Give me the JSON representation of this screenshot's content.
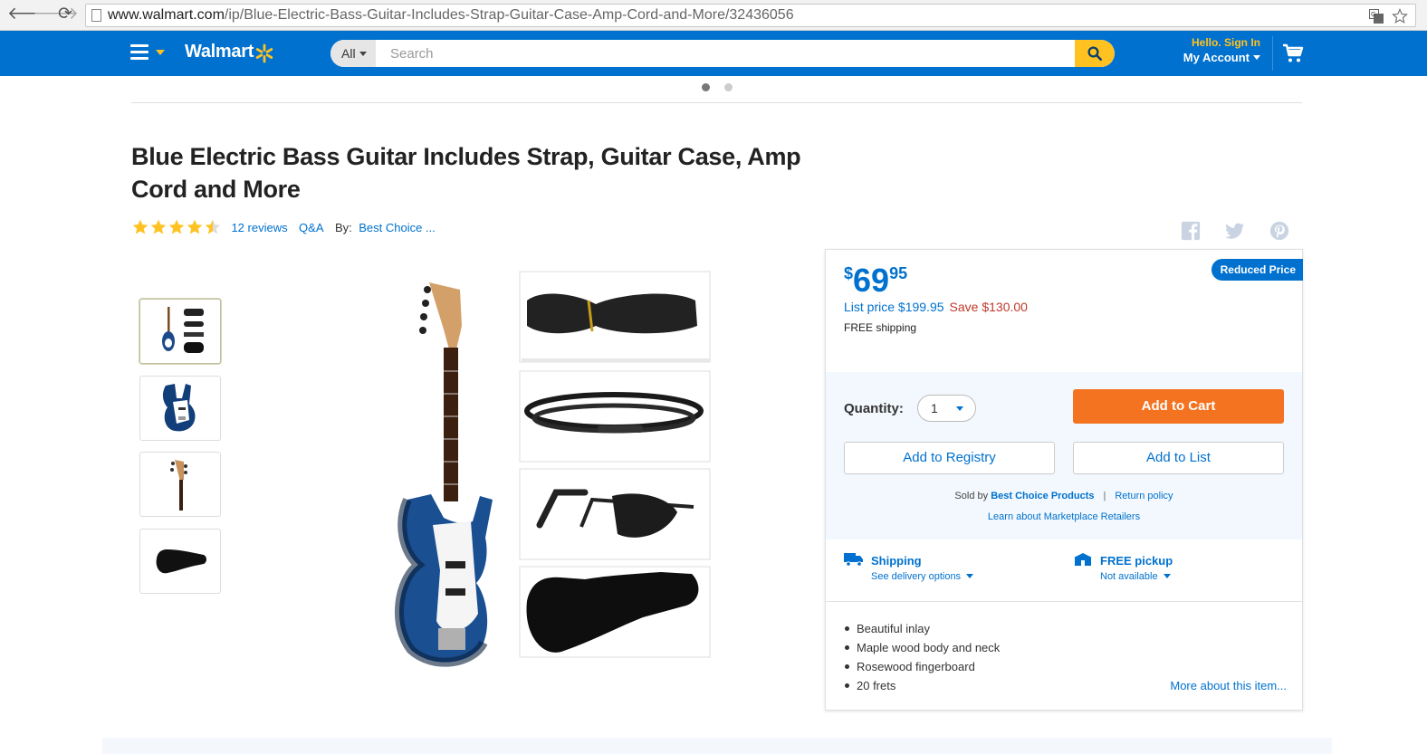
{
  "browser": {
    "url_domain": "www.walmart.com",
    "url_path": "/ip/Blue-Electric-Bass-Guitar-Includes-Strap-Guitar-Case-Amp-Cord-and-More/32436056",
    "back_icon": "arrow-left",
    "forward_icon": "arrow-right",
    "reload_icon": "reload",
    "back_glyph": "🡐",
    "forward_glyph": "🡒",
    "reload_glyph": "⟳"
  },
  "header": {
    "logo_text": "Walmart",
    "brand_blue": "#0071ce",
    "brand_yellow": "#ffc220",
    "search": {
      "department": "All",
      "placeholder": "Search"
    },
    "account": {
      "greeting": "Hello. Sign In",
      "label": "My Account"
    }
  },
  "product": {
    "title": "Blue Electric Bass Guitar Includes Strap, Guitar Case, Amp Cord and More",
    "rating": 4.5,
    "reviews_label": "12 reviews",
    "qa_label": "Q&A",
    "by_label": "By:",
    "brand_label": "Best Choice ..."
  },
  "social": [
    "facebook-icon",
    "twitter-icon",
    "pinterest-icon"
  ],
  "buybox": {
    "badge": "Reduced Price",
    "price_currency": "$",
    "price_dollars": "69",
    "price_cents": "95",
    "list_price": "List price $199.95",
    "save": "Save $130.00",
    "shipping_note": "FREE shipping",
    "quantity_label": "Quantity:",
    "quantity_value": "1",
    "add_to_cart": "Add to Cart",
    "add_to_registry": "Add to Registry",
    "add_to_list": "Add to List",
    "sold_by_label": "Sold by",
    "seller": "Best Choice Products",
    "separator": "|",
    "return_policy": "Return policy",
    "learn_marketplace": "Learn about Marketplace Retailers",
    "shipping_title": "Shipping",
    "shipping_sub": "See delivery options",
    "pickup_title": "FREE pickup",
    "pickup_sub": "Not available",
    "features": [
      "Beautiful inlay",
      "Maple wood body and neck",
      "Rosewood fingerboard",
      "20 frets"
    ],
    "more_link": "More about this item...",
    "accent_orange": "#f47321",
    "save_red": "#c0392b"
  }
}
